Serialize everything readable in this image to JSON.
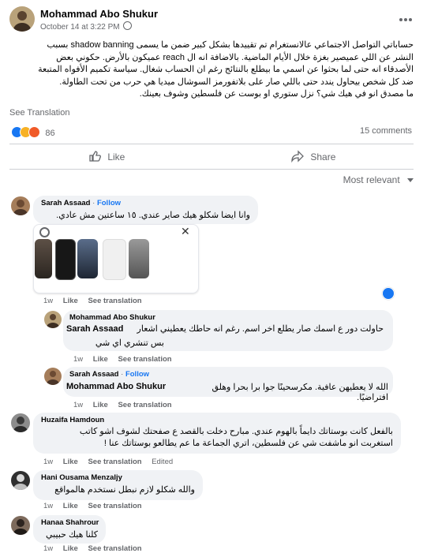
{
  "post": {
    "author": "Mohammad Abo Shukur",
    "timestamp": "October 14 at 3:22 PM",
    "body_lines": [
      "حساباتي التواصل الاجتماعي عالانستغرام تم تقييدها بشكل كبير ضمن ما يسمى shadow banning بسبب",
      "النشر عن اللي عميصير بغزة خلال الأيام الماضية. بالاضافة انه ال reach عميكون بالأرض. حكوني بعض",
      "الأصدقاء انه حتى لما بحثوا عن اسمي ما بيطلع بالنتائج رغم ان الحساب شغال. سياسة تكميم الأفواه المتبعة",
      "ضد كل شخص بيحاول يندد حتى باللي صار على بلاتفورمز السوشال ميديا هي حرب من تحت الطاولة.",
      "ما مصدق انو في هيك شي؟ نزل ستوري او بوست عن فلسطين وشوف بعينك."
    ],
    "see_translation": "See Translation",
    "reaction_count": "86",
    "comments_count": "15 comments",
    "like_label": "Like",
    "share_label": "Share",
    "sort_label": "Most relevant",
    "colors": {
      "blue": "#1877f2",
      "angry": "#f05a28",
      "haha": "#f7b125"
    }
  },
  "comments": [
    {
      "author": "Sarah Assaad",
      "follow": "Follow",
      "text": "وانا ايضا شكلو هيك صاير عندي. ١٥ ساعتين مش عادي.",
      "time": "1w",
      "like": "Like",
      "see_translation": "See translation"
    },
    {
      "author": "Mohammad Abo Shukur",
      "mention": "Sarah Assaad",
      "text_line1": "حاولت دور ع اسمك صار يطلع اخر اسم. رغم انه حاطك يعطيني اشعار",
      "text_line2": "بس تنشري اي شي",
      "time": "1w",
      "like": "Like",
      "see_translation": "See translation"
    },
    {
      "author": "Sarah Assaad",
      "follow": "Follow",
      "mention": "Mohammad Abo Shukur",
      "text": "الله لا يعطيهن عافية. مكرسحينًا جوا برا بحرا وهلق افتراضيًا.",
      "time": "1w",
      "like": "Like",
      "see_translation": "See translation"
    },
    {
      "author": "Huzaifa Hamdoun",
      "text_lines": [
        "بالفعل كانت بوستاتك دايماً بالهوم عندي. مبارح دخلت بالقصد ع صفحتك لشوف اشو كاتب",
        "استغربت انو ماشفت شي عن فلسطين، اتري الجماعة ما عم يطالعو بوستاتك عنا !"
      ],
      "time": "1w",
      "like": "Like",
      "see_translation": "See translation",
      "edited": "Edited"
    },
    {
      "author": "Hani Ousama Menzaljy",
      "text": "والله شكلو لازم نبطل نستخدم هالمواقع",
      "time": "1w",
      "like": "Like",
      "see_translation": "See translation"
    },
    {
      "author": "Hanaa Shahrour",
      "text": "كلنا هيك حبيبي",
      "time": "1w",
      "like": "Like",
      "see_translation": "See translation"
    }
  ]
}
